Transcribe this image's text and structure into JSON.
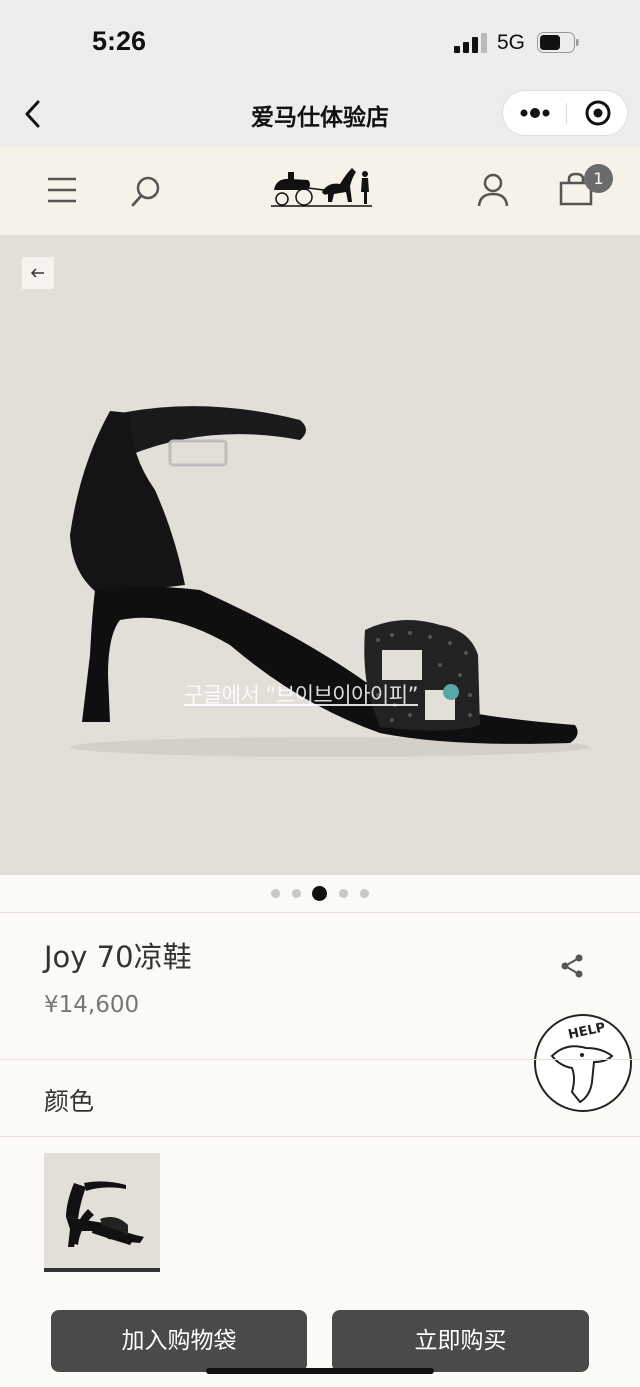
{
  "status_bar": {
    "time": "5:26",
    "network": "5G"
  },
  "nav": {
    "title": "爱马仕体验店"
  },
  "header": {
    "cart_count": "1"
  },
  "gallery": {
    "watermark": "구글에서 “브이브이아이피”",
    "total_images": 5,
    "active_index": 2
  },
  "product": {
    "name": "Joy 70凉鞋",
    "price": "¥14,600"
  },
  "color_section": {
    "label": "颜色"
  },
  "help_badge": {
    "label": "HELP"
  },
  "actions": {
    "add_to_bag": "加入购物袋",
    "buy_now": "立即购买"
  },
  "colors": {
    "header_bg": "#f6f1e9",
    "photo_bg": "#e2dfd9",
    "button_bg": "#4a4a4a"
  }
}
